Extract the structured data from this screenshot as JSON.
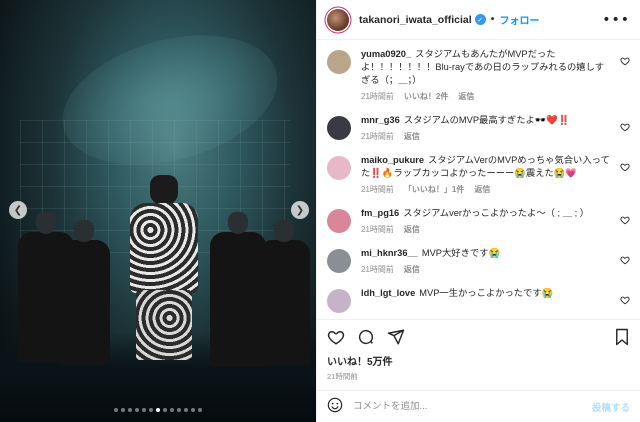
{
  "post": {
    "author": "takanori_iwata_official",
    "separator": "•",
    "follow_label": "フォロー",
    "more_label": "•••",
    "likes": "いいね！5万件",
    "time": "21時間前",
    "media_dots_total": 13,
    "media_dots_active": 6
  },
  "comments": [
    {
      "user": "yuma0920_",
      "text": "スタジアムもあんたがMVPだったよ！！！！！！！Blu-rayであの日のラップみれるの嬉しすぎる（；＿；）",
      "time": "21時間前",
      "likes": "いいね！2件",
      "reply": "返信",
      "avatar_color": "#b9a58a"
    },
    {
      "user": "mnr_g36",
      "text": "スタジアムのMVP最高すぎたよ🕶️❤️‼️",
      "time": "21時間前",
      "likes": "",
      "reply": "返信",
      "avatar_color": "#3a3a44"
    },
    {
      "user": "maiko_pukure",
      "text": "スタジアムVerのMVPめっちゃ気合い入ってた‼️🔥ラップカッコよかったーーー😭震えた😭💗",
      "time": "21時間前",
      "likes": "「いいね！」1件",
      "reply": "返信",
      "avatar_color": "#e8b8c8"
    },
    {
      "user": "fm_pg16",
      "text": "スタジアムverかっこよかったよ〜（ ;  ＿ ; ）",
      "time": "21時間前",
      "likes": "",
      "reply": "返信",
      "avatar_color": "#d9869b"
    },
    {
      "user": "mi_hknr36__",
      "text": "MVP大好きです😭",
      "time": "21時間前",
      "likes": "",
      "reply": "返信",
      "avatar_color": "#8a8f96"
    },
    {
      "user": "ldh_lgt_love",
      "text": "MVP一生かっこよかったです😭",
      "time": "",
      "likes": "",
      "reply": "",
      "avatar_color": "#c6b2c9"
    }
  ],
  "composer": {
    "placeholder": "コメントを追加...",
    "post_label": "投稿する"
  },
  "icons": {
    "heart": "heart-icon",
    "comment": "comment-icon",
    "share": "share-icon",
    "bookmark": "bookmark-icon",
    "emoji": "emoji-icon",
    "prev": "chevron-left-icon",
    "next": "chevron-right-icon"
  }
}
